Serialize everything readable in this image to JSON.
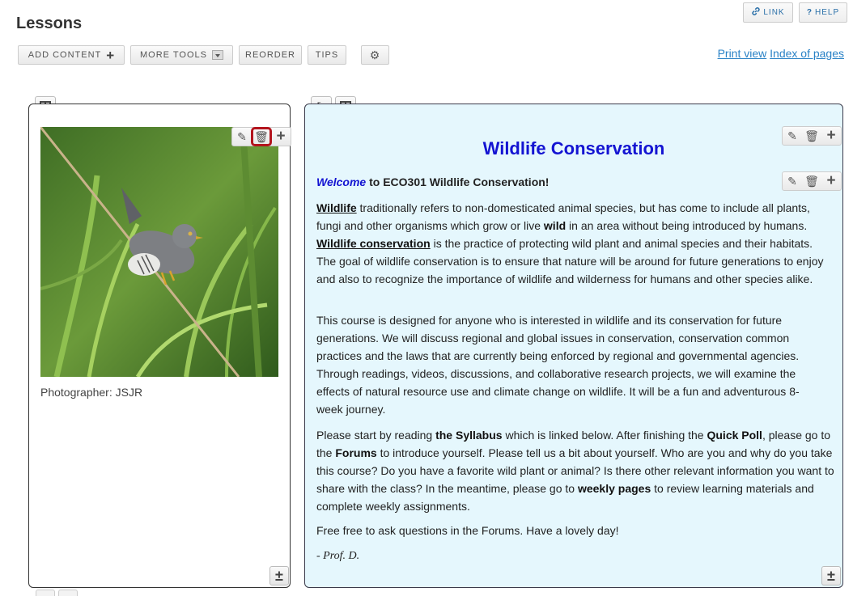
{
  "page": {
    "title": "Lessons"
  },
  "toolbar": {
    "add_content": "ADD CONTENT",
    "more_tools": "MORE TOOLS",
    "reorder": "REORDER",
    "tips": "TIPS"
  },
  "top_buttons": {
    "link": "LINK",
    "help": "HELP"
  },
  "top_links": {
    "print_view": "Print view",
    "index_of_pages": "Index of pages"
  },
  "left_column": {
    "image_caption": "Photographer: JSJR"
  },
  "right_column": {
    "heading": "Wildlife Conservation",
    "welcome_em": "Welcome",
    "welcome_rest": " to ECO301 Wildlife Conservation!",
    "p1": {
      "term1": "Wildlife",
      "t1": " traditionally refers to non-domesticated animal species, but has come to include all plants, fungi and other organisms which grow or live ",
      "bold1": "wild",
      "t2": " in an area without being introduced by humans. ",
      "term2": "Wildlife conservation",
      "t3": " is the practice of protecting wild plant and animal species and their habitats. The goal of wildlife conservation is to ensure that nature will be around for future generations to enjoy and also to recognize the importance of wildlife and wilderness for humans and other species alike."
    },
    "p2": "This course is designed for anyone who is interested in wildlife and its conservation for future generations. We will discuss regional and global issues in conservation, conservation common practices and the laws that are currently being enforced by regional and governmental agencies. Through readings, videos, discussions, and collaborative research projects, we will examine the effects of natural resource use and climate change on wildlife. It will be a fun and adventurous 8-week journey.",
    "p3": {
      "t1": "Please start by reading ",
      "b1": "the Syllabus",
      "t2": " which is linked below. After finishing the ",
      "b2": "Quick Poll",
      "t3": ", please go to the ",
      "b3": "Forums",
      "t4": " to introduce yourself. Please tell us a bit about yourself. Who are you and why do you take this course? Do you have a favorite wild plant or animal? Is there other relevant information you want to share with the class? In the meantime, please go to ",
      "b4": "weekly pages",
      "t5": " to review learning materials and complete weekly assignments."
    },
    "p4": "Free free to ask questions in the Forums. Have a lovely day!",
    "signature": "- Prof. D."
  },
  "icons": {
    "add": "plus-icon",
    "more_caret": "caret-down-icon",
    "settings": "gear-icon",
    "link": "link-icon",
    "help": "question-icon",
    "edit": "pencil-icon",
    "delete": "trash-icon",
    "columns": "columns-icon",
    "shrink": "collapse-icon"
  },
  "colors": {
    "heading": "#1414d2",
    "link": "#2a82c6",
    "right_bg": "#e5f7fd",
    "highlight": "#b3141d"
  }
}
